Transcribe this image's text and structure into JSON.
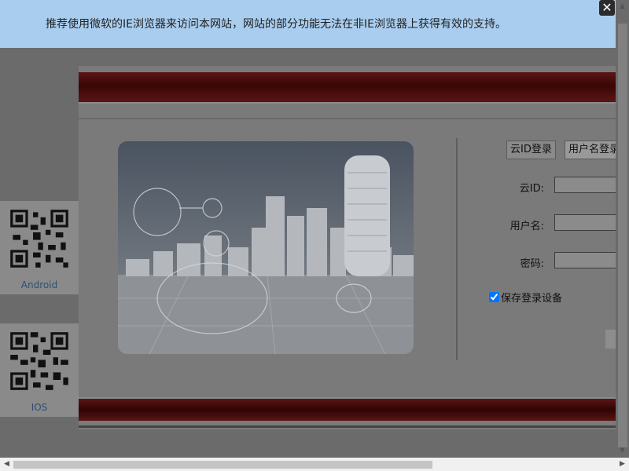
{
  "ie_bar": {
    "message": "推荐使用微软的IE浏览器来访问本网站，网站的部分功能无法在非IE浏览器上获得有效的支持。",
    "close_icon": "close-icon"
  },
  "login": {
    "tabs": [
      "云ID登录",
      "用户名登录"
    ],
    "fields": {
      "cloud_id_label": "云ID:",
      "username_label": "用户名:",
      "password_label": "密码:"
    },
    "remember_label": "保存登录设备",
    "remember_checked": true
  },
  "qr": {
    "android_caption": "Android",
    "ios_caption": "IOS"
  },
  "colors": {
    "banner": "#a9cdef",
    "band": "#4a0b0b",
    "caption": "#2f4d73"
  }
}
